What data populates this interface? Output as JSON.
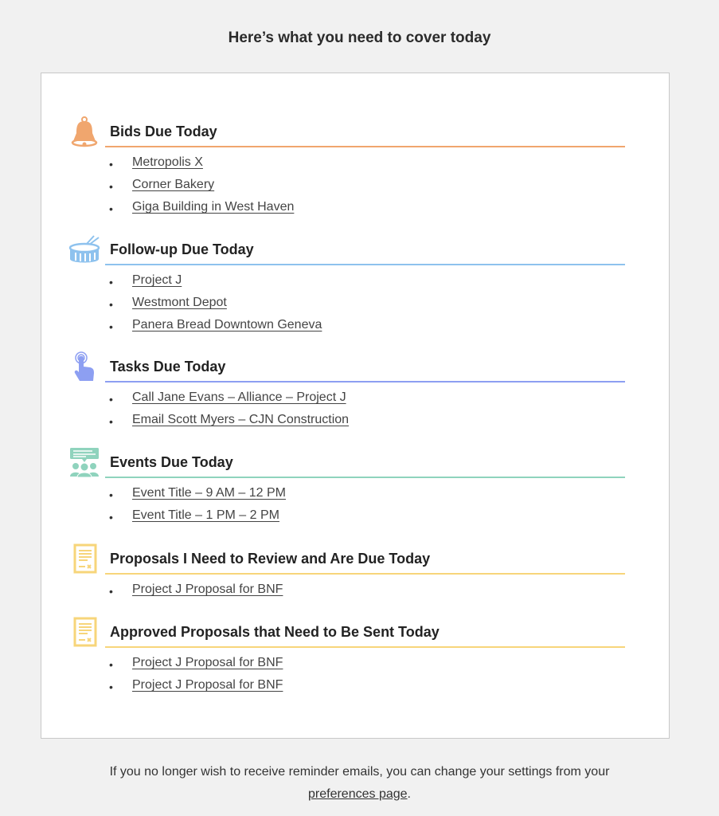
{
  "header": {
    "title": "Here’s what you need to cover today"
  },
  "sections": [
    {
      "title": "Bids Due Today",
      "icon": "bell-icon",
      "color": "#f0a66e",
      "items": [
        "Metropolis X",
        "Corner Bakery",
        "Giga Building in West Haven"
      ]
    },
    {
      "title": "Follow-up Due Today",
      "icon": "drum-icon",
      "color": "#8ec2ee",
      "items": [
        "Project J",
        "Westmont Depot",
        "Panera Bread Downtown Geneva"
      ]
    },
    {
      "title": "Tasks Due Today",
      "icon": "tap-hand-icon",
      "color": "#8d9ff2",
      "items": [
        "Call Jane Evans – Alliance – Project J",
        "Email Scott Myers – CJN Construction"
      ]
    },
    {
      "title": "Events Due Today",
      "icon": "meeting-icon",
      "color": "#8fd3bd",
      "items": [
        "Event Title – 9 AM – 12 PM",
        "Event Title – 1 PM – 2 PM"
      ]
    },
    {
      "title": "Proposals I Need to Review and Are Due Today",
      "icon": "document-icon",
      "color": "#f7d57a",
      "items": [
        "Project J Proposal for BNF"
      ]
    },
    {
      "title": "Approved Proposals that Need to Be Sent Today",
      "icon": "document-icon",
      "color": "#f7d57a",
      "items": [
        "Project J Proposal for BNF",
        "Project J Proposal for BNF"
      ]
    }
  ],
  "footer": {
    "text": "If you no longer wish to receive reminder emails, you can change your settings from your",
    "link_label": "preferences page",
    "suffix": "."
  }
}
